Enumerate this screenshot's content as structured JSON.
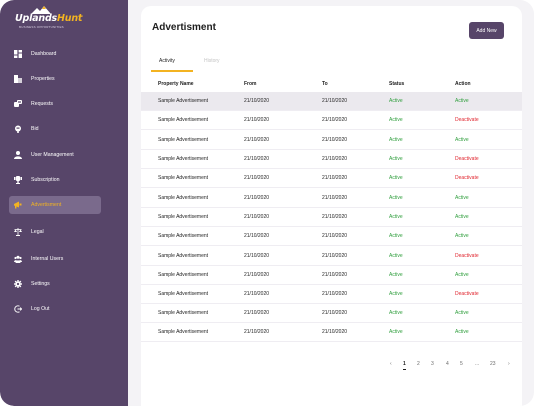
{
  "brand": {
    "name_a": "Uplands",
    "name_b": "Hunt",
    "tagline": "BUSINESS OPPORTUNITIES"
  },
  "sidebar": {
    "items": [
      {
        "label": "Dashboard",
        "icon": "dashboard-icon"
      },
      {
        "label": "Properties",
        "icon": "properties-icon"
      },
      {
        "label": "Requests",
        "icon": "requests-icon"
      },
      {
        "label": "Bid",
        "icon": "bid-icon"
      },
      {
        "label": "User Management",
        "icon": "user-icon"
      },
      {
        "label": "Subscription",
        "icon": "subscription-icon"
      },
      {
        "label": "Advertisment",
        "icon": "megaphone-icon",
        "active": true
      },
      {
        "label": "Legal",
        "icon": "scales-icon"
      },
      {
        "label": "Internal Users",
        "icon": "users-icon"
      },
      {
        "label": "Settings",
        "icon": "gear-icon"
      },
      {
        "label": "Log Out",
        "icon": "logout-icon"
      }
    ]
  },
  "page": {
    "title": "Advertisment",
    "add_button": "Add New"
  },
  "tabs": {
    "activity": "Activity",
    "history": "History"
  },
  "table": {
    "headers": [
      "Property Name",
      "From",
      "To",
      "Status",
      "Action"
    ],
    "rows": [
      [
        "Sample Advertisement",
        "21/10/2020",
        "21/10/2020",
        "Active",
        "Active"
      ],
      [
        "Sample Advertisement",
        "21/10/2020",
        "21/10/2020",
        "Active",
        "Deactivate"
      ],
      [
        "Sample Advertisement",
        "21/10/2020",
        "21/10/2020",
        "Active",
        "Active"
      ],
      [
        "Sample Advertisement",
        "21/10/2020",
        "21/10/2020",
        "Active",
        "Deactivate"
      ],
      [
        "Sample Advertisement",
        "21/10/2020",
        "21/10/2020",
        "Active",
        "Deactivate"
      ],
      [
        "Sample Advertisement",
        "21/10/2020",
        "21/10/2020",
        "Active",
        "Active"
      ],
      [
        "Sample Advertisement",
        "21/10/2020",
        "21/10/2020",
        "Active",
        "Active"
      ],
      [
        "Sample Advertisement",
        "21/10/2020",
        "21/10/2020",
        "Active",
        "Active"
      ],
      [
        "Sample Advertisement",
        "21/10/2020",
        "21/10/2020",
        "Active",
        "Deactivate"
      ],
      [
        "Sample Advertisement",
        "21/10/2020",
        "21/10/2020",
        "Active",
        "Active"
      ],
      [
        "Sample Advertisement",
        "21/10/2020",
        "21/10/2020",
        "Active",
        "Deactivate"
      ],
      [
        "Sample Advertisement",
        "21/10/2020",
        "21/10/2020",
        "Active",
        "Active"
      ],
      [
        "Sample Advertisement",
        "21/10/2020",
        "21/10/2020",
        "Active",
        "Active"
      ]
    ]
  },
  "pagination": {
    "prev": "‹",
    "pages": [
      "1",
      "2",
      "3",
      "4",
      "5",
      "...",
      "23"
    ],
    "current": "1",
    "next": "›"
  },
  "colors": {
    "sidebar": "#574569",
    "accent": "#f3b321",
    "active_green": "#2e9e3c",
    "deactivate_red": "#e0252e"
  }
}
